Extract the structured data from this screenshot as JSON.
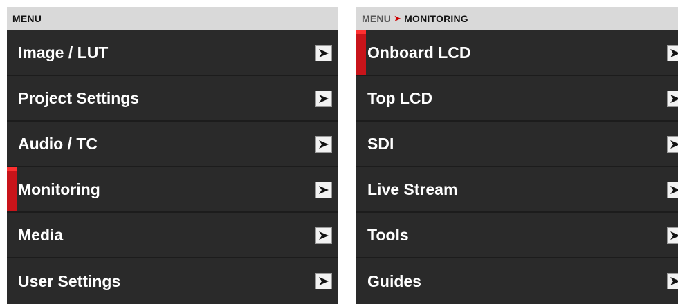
{
  "left_panel": {
    "header": "MENU",
    "items": [
      {
        "label": "Image / LUT",
        "selected": false
      },
      {
        "label": "Project Settings",
        "selected": false
      },
      {
        "label": "Audio / TC",
        "selected": false
      },
      {
        "label": "Monitoring",
        "selected": true
      },
      {
        "label": "Media",
        "selected": false
      },
      {
        "label": "User Settings",
        "selected": false
      }
    ]
  },
  "right_panel": {
    "breadcrumb": {
      "parent": "MENU",
      "separator": "➤",
      "current": "MONITORING"
    },
    "items": [
      {
        "label": "Onboard LCD",
        "selected": true
      },
      {
        "label": "Top LCD",
        "selected": false
      },
      {
        "label": "SDI",
        "selected": false
      },
      {
        "label": "Live Stream",
        "selected": false
      },
      {
        "label": "Tools",
        "selected": false
      },
      {
        "label": "Guides",
        "selected": false
      }
    ]
  },
  "icons": {
    "item_arrow": "chevron-right-icon"
  },
  "colors": {
    "background": "#2a2a2a",
    "header": "#d9d9d9",
    "accent": "#c8141a"
  }
}
